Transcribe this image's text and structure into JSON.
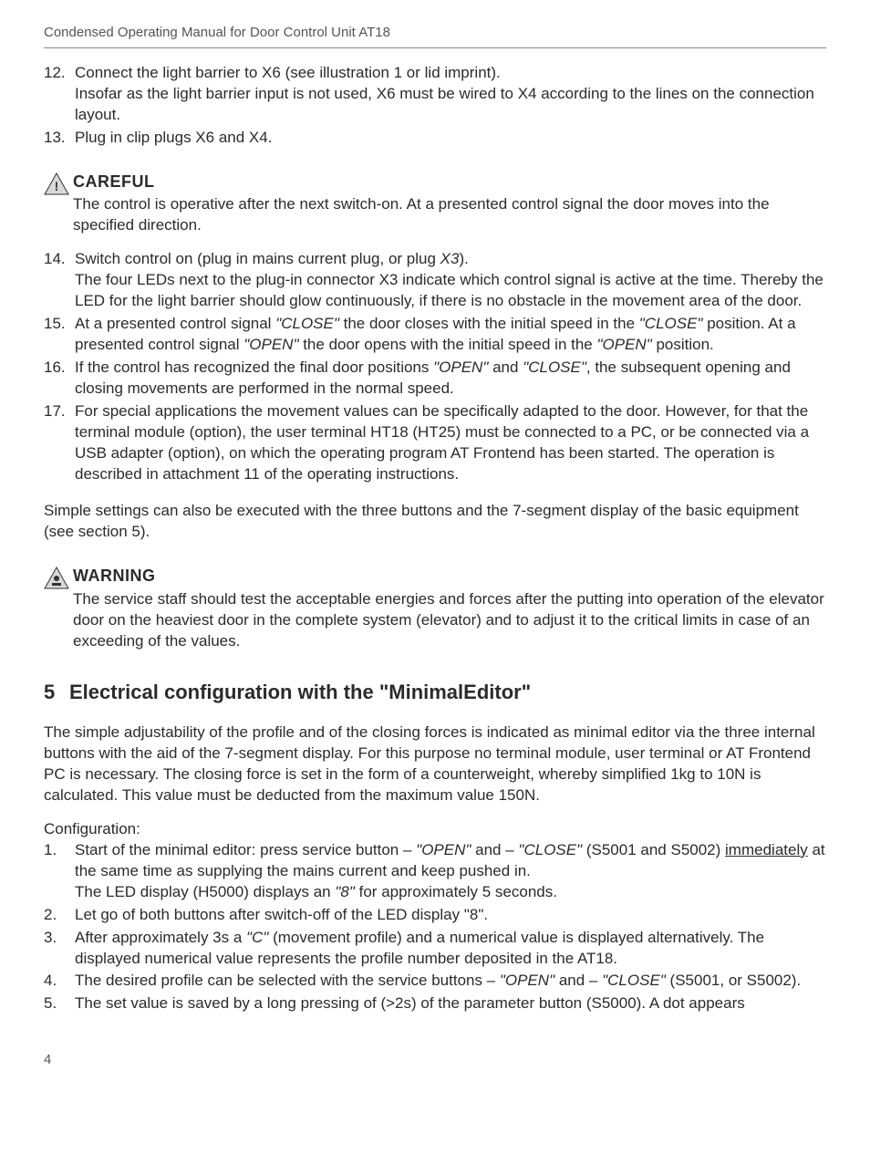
{
  "header": "Condensed Operating Manual for Door Control Unit AT18",
  "list1": {
    "i12": {
      "num": "12.",
      "t1": "Connect the light barrier to X6 (see illustration 1 or lid imprint).",
      "t2": "Insofar as the light barrier input is not used, X6 must be wired to X4 according to the lines on the connection layout."
    },
    "i13": {
      "num": "13.",
      "t": "Plug in clip plugs X6 and X4."
    }
  },
  "careful": {
    "title": "CAREFUL",
    "body": "The control is operative after the next switch-on. At a presented control signal the door moves into the specified direction."
  },
  "list2": {
    "i14": {
      "num": "14.",
      "t1a": "Switch control on (plug in mains current plug, or plug ",
      "t1b": "X3",
      "t1c": ").",
      "t2": "The four LEDs next to the plug-in connector X3 indicate which control signal is active at the time. Thereby the LED for the light barrier should glow continuously, if there is no obstacle in the movement area of the door."
    },
    "i15": {
      "num": "15.",
      "a": "At a presented control signal ",
      "b": "\"CLOSE\"",
      "c": " the door closes with the initial speed in the ",
      "d": "\"CLOSE\"",
      "e": " position. At a presented control signal ",
      "f": "\"OPEN\"",
      "g": " the door opens with the initial speed in the ",
      "h": "\"OPEN\"",
      "i": " position."
    },
    "i16": {
      "num": "16.",
      "a": "If the control has recognized the final door positions ",
      "b": "\"OPEN\"",
      "c": " and ",
      "d": "\"CLOSE\"",
      "e": ", the subsequent opening and closing movements are performed in the normal speed."
    },
    "i17": {
      "num": "17.",
      "t": "For special applications the movement values can be specifically adapted to the door. However, for that the terminal module (option), the user terminal HT18 (HT25) must be connected to a PC, or be connected via a USB adapter (option), on which the operating program AT Frontend has been started. The operation is described in attachment 11 of the operating instructions."
    }
  },
  "simple": "Simple settings can also be executed with the three buttons and the 7-segment display of the basic equipment (see section 5).",
  "warning": {
    "title": "WARNING",
    "body": "The service staff should test the acceptable energies and forces after the putting into operation of the elevator door on the heaviest door in the complete system (elevator) and to adjust it to the critical limits in case of an exceeding of the values."
  },
  "section": {
    "num": "5",
    "title": "Electrical configuration with the \"MinimalEditor\""
  },
  "intro": "The simple adjustability of the profile and of the closing forces is indicated as minimal editor via the three internal buttons with the aid of the 7-segment display. For this purpose no terminal module, user terminal or AT Frontend PC is necessary. The closing force is set in the form of a counterweight, whereby simplified 1kg to 10N is calculated. This value must be deducted from the maximum value 150N.",
  "config_label": "Configuration:",
  "list3": {
    "i1": {
      "num": "1.",
      "a": "Start of the minimal editor: press service button – ",
      "b": "\"OPEN\"",
      "c": " and – ",
      "d": "\"CLOSE\"",
      "e": " (S5001 and S5002) ",
      "f": "immediately",
      "g": " at the same time as supplying the mains current and keep pushed in.",
      "l2a": "The LED display (H5000) displays an ",
      "l2b": "\"8\"",
      "l2c": " for approximately 5 seconds."
    },
    "i2": {
      "num": "2.",
      "t": "Let go of both buttons after switch-off of the LED display \"8\"."
    },
    "i3": {
      "num": "3.",
      "a": "After approximately 3s a ",
      "b": "\"C\"",
      "c": " (movement profile) and a numerical value is displayed alternatively. The displayed numerical value represents the profile number deposited in the AT18."
    },
    "i4": {
      "num": "4.",
      "a": "The desired profile can be selected with the service buttons – ",
      "b": "\"OPEN\"",
      "c": " and – ",
      "d": "\"CLOSE\"",
      "e": " (S5001, or S5002)."
    },
    "i5": {
      "num": "5.",
      "t": "The set value is saved by a long pressing of (>2s) of the parameter button (S5000). A dot appears"
    }
  },
  "page": "4"
}
